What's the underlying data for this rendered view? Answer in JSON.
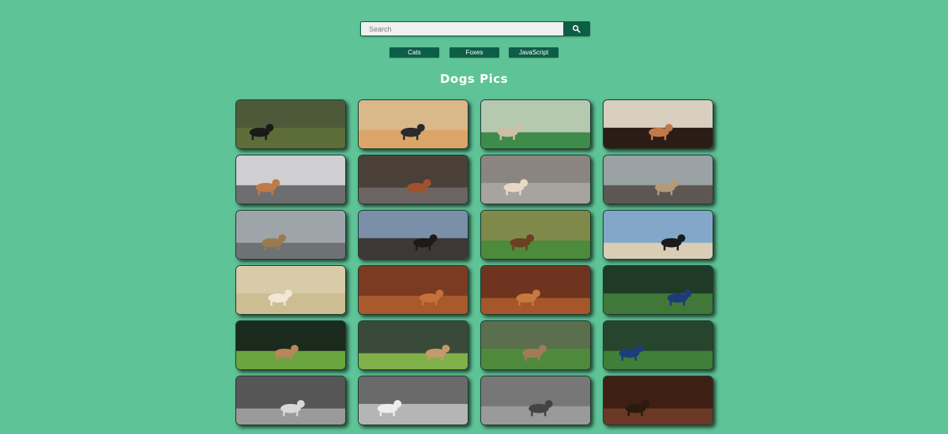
{
  "search": {
    "placeholder": "Search"
  },
  "nav": {
    "items": [
      "Cats",
      "Foxes",
      "JavaScript"
    ]
  },
  "page_title": "Dogs Pics",
  "photos": [
    {
      "sky": "#4c5a3a",
      "ground": "#5c6d3a",
      "dog": "#1a1a1a"
    },
    {
      "sky": "#d9b88a",
      "ground": "#dba56a",
      "dog": "#2a2a2a"
    },
    {
      "sky": "#b5c8b0",
      "ground": "#3f8c4a",
      "dog": "#cdbfa5"
    },
    {
      "sky": "#d8cfc0",
      "ground": "#2b1d16",
      "dog": "#c07a4a"
    },
    {
      "sky": "#cfcfd1",
      "ground": "#6e6e70",
      "dog": "#c07a45"
    },
    {
      "sky": "#4a4038",
      "ground": "#6b6462",
      "dog": "#a0522d"
    },
    {
      "sky": "#8a8580",
      "ground": "#a7a39e",
      "dog": "#e7d9c5"
    },
    {
      "sky": "#9aa2a6",
      "ground": "#5c5752",
      "dog": "#b39b7a"
    },
    {
      "sky": "#9ea5aa",
      "ground": "#6e7275",
      "dog": "#9c7a4f"
    },
    {
      "sky": "#7a8fa8",
      "ground": "#3d3836",
      "dog": "#1f1a17"
    },
    {
      "sky": "#7f8a4a",
      "ground": "#4b8b3b",
      "dog": "#6b3f20"
    },
    {
      "sky": "#82a7c8",
      "ground": "#d9cdb6",
      "dog": "#1a1a1a"
    },
    {
      "sky": "#d8cba8",
      "ground": "#cdbd93",
      "dog": "#f1e7d6"
    },
    {
      "sky": "#7a3b22",
      "ground": "#a85a2d",
      "dog": "#c4713a"
    },
    {
      "sky": "#6e3420",
      "ground": "#a5562b",
      "dog": "#c77a3f"
    },
    {
      "sky": "#1f3b28",
      "ground": "#3f7838",
      "dog": "#1f3a78"
    },
    {
      "sky": "#1a2a1c",
      "ground": "#6aa53f",
      "dog": "#b8875a"
    },
    {
      "sky": "#3a4a3a",
      "ground": "#7fb04a",
      "dog": "#c49a6c"
    },
    {
      "sky": "#5b6e4e",
      "ground": "#4f8a3c",
      "dog": "#a47a5a"
    },
    {
      "sky": "#27452d",
      "ground": "#3f7f3a",
      "dog": "#1d3d7a"
    },
    {
      "sky": "#565656",
      "ground": "#9a9a9a",
      "dog": "#d8d8d8"
    },
    {
      "sky": "#6a6a6a",
      "ground": "#b5b5b5",
      "dog": "#ededed"
    },
    {
      "sky": "#777777",
      "ground": "#9a9a9a",
      "dog": "#444444"
    },
    {
      "sky": "#3f1f14",
      "ground": "#6b3826",
      "dog": "#2a1a10"
    }
  ]
}
